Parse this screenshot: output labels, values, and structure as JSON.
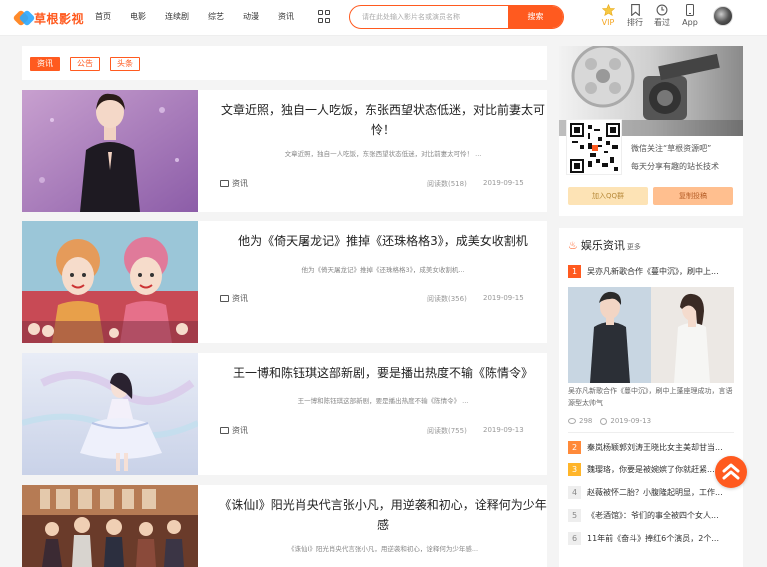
{
  "header": {
    "logo_text": "草根影视",
    "nav": [
      "首页",
      "电影",
      "连续剧",
      "综艺",
      "动漫",
      "资讯"
    ],
    "search_placeholder": "请在此处输入影片名或演员名称",
    "search_button": "搜索",
    "icons": [
      {
        "name": "vip-icon",
        "label": "VIP"
      },
      {
        "name": "ranking-icon",
        "label": "排行"
      },
      {
        "name": "history-icon",
        "label": "看过"
      },
      {
        "name": "app-icon",
        "label": "App"
      }
    ],
    "accent_color": "#ff5a1f",
    "vip_color": "#f5a623"
  },
  "tags": [
    "资讯",
    "公告",
    "头条"
  ],
  "articles": [
    {
      "title": "文章近照，独自一人吃饭，东张西望状态低迷，对比前妻太可怜！",
      "summary": "文章近照，独自一人吃饭，东张西望状态低迷，对比前妻太可怜！ ...",
      "category": "资讯",
      "views": "阅读数(518)",
      "date": "2019-09-15"
    },
    {
      "title": "他为《倚天屠龙记》推掉《还珠格格3》，成美女收割机",
      "summary": "他为《倚天屠龙记》推掉《还珠格格3》，成美女收割机...",
      "category": "资讯",
      "views": "阅读数(356)",
      "date": "2019-09-15"
    },
    {
      "title": "王一博和陈钰琪这部新剧，要是播出热度不输《陈情令》",
      "summary": "王一博和陈钰琪这部新剧，要是播出热度不输《陈情令》 ...",
      "category": "资讯",
      "views": "阅读数(755)",
      "date": "2019-09-13"
    },
    {
      "title": "《诛仙Ⅰ》阳光肖央代言张小凡，用逆袭和初心，诠释何为少年感",
      "summary": "《诛仙Ⅰ》阳光肖央代言张小凡，用逆袭和初心，诠释何为少年感..."
    }
  ],
  "sidebar": {
    "follow_text": "微信关注“草根资源吧”",
    "follow_sub": "每天分享有趣的站长技术",
    "join_button": "加入QQ群",
    "contrib_button": "复制投稿",
    "news_title": "娱乐资讯",
    "news_more": "更多",
    "ranks": [
      {
        "num": "1",
        "text": "吴亦凡新歌合作《蔓中沉》，刷中上..."
      },
      {
        "num": "2",
        "text": "秦岚杨颖郭刘涛王晓比女主美却甘当..."
      },
      {
        "num": "3",
        "text": "魏璎珞，你要是被婉嫔了你就赶紧..."
      },
      {
        "num": "4",
        "text": "赵薇被怀二胎？小腹隆起明显，工作..."
      },
      {
        "num": "5",
        "text": "《老酒馆》：爷们的事全被四个女人..."
      },
      {
        "num": "6",
        "text": "11年前《奋斗》捧红6个演员，2个..."
      }
    ],
    "feature_caption": "吴亦凡新歌合作《蔓中沉》，刷中上蓬座理成功，言语源型太帅气",
    "feature_views": "298",
    "feature_date": "2019-09-13"
  }
}
